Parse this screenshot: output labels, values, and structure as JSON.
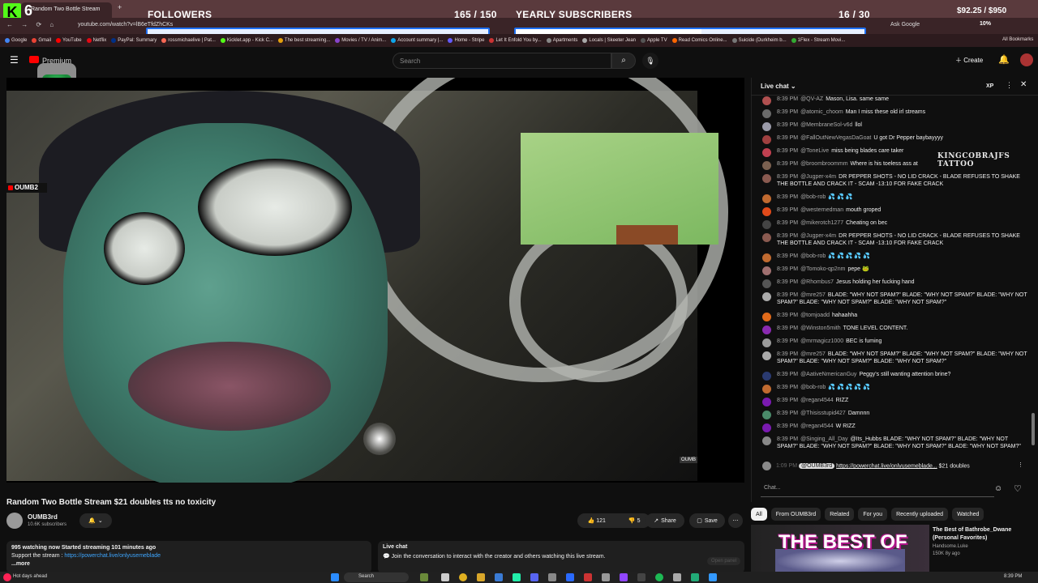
{
  "overlay": {
    "kick_logo": "K",
    "kick_count": "6",
    "followers_title": "FOLLOWERS",
    "followers_count": "165 / 150",
    "followers_progress": 1.0,
    "subs_title": "YEARLY SUBSCRIBERS",
    "subs_count": "16 / 30",
    "subs_progress": 0.533,
    "money": "$92.25 / $950",
    "progress_color": "#1d6ff2"
  },
  "browser": {
    "tab_title": "Random Two Bottle Stream",
    "new_tab": "+",
    "url": "youtube.com/watch?v=lB6eTfdZhCKs",
    "ask_google": "Ask Google",
    "zoom": "10%",
    "all_bookmarks": "All Bookmarks",
    "bookmarks": [
      "Google",
      "Gmail",
      "YouTube",
      "Netflix",
      "PayPal: Summary",
      "rossmichaelive | Pat...",
      "Kicklet.app - Kick C...",
      "The best streaming...",
      "Movies / TV / Anim...",
      "Account summary |...",
      "Home - Stripe",
      "Let It Enfold You by...",
      "Apartments",
      "Locals | Skeeter Jean",
      "Apple TV",
      "Read Comics Online...",
      "Suicide (Durkheim b...",
      "1Flex - Stream Movi..."
    ]
  },
  "yt": {
    "premium": "Premium",
    "search_placeholder": "Search",
    "create": "Create"
  },
  "video": {
    "channel_badge": "OUMB2",
    "corner_tag": "OUMB"
  },
  "below": {
    "title": "Random Two Bottle Stream $21 doubles tts no toxicity",
    "channel": "OUMB3rd",
    "subs": "10.6K subscribers",
    "likes": "121",
    "dislikes": "5",
    "share": "Share",
    "save": "Save",
    "watching": "995 watching now  Started streaming 101 minutes ago",
    "support": "Support the stream : ",
    "support_link": "https://powerchat.live/onlyusemeblade",
    "more": "...more",
    "livechat_title": "Live chat",
    "livechat_text": "Join the conversation to interact with the creator and others watching this live stream.",
    "open_panel": "Open panel"
  },
  "chat": {
    "header": "Live chat",
    "xp": "XP",
    "watermark": "KINGCOBRAJFS TATTOO",
    "messages": [
      {
        "time": "8:39 PM",
        "name": "@QV-AZ",
        "text": "Mason, Lisa. same same",
        "color": "#b05050"
      },
      {
        "time": "8:39 PM",
        "name": "@atomic_choom",
        "text": "Man I miss these old irl streams",
        "color": "#6a6a6a"
      },
      {
        "time": "8:39 PM",
        "name": "@MembraneSol-v6d",
        "text": "llol",
        "color": "#9a9aa8"
      },
      {
        "time": "8:39 PM",
        "name": "@FallOutNewVegasDaGoat",
        "text": "U got Dr Pepper baybayyyy",
        "color": "#a04040"
      },
      {
        "time": "8:39 PM",
        "name": "@ToneLive",
        "text": "miss being blades care taker",
        "color": "#c04050"
      },
      {
        "time": "8:39 PM",
        "name": "@broombroommm",
        "text": "Where is his toeless ass at",
        "color": "#7a6050"
      },
      {
        "time": "8:39 PM",
        "name": "@Jugper-x4m",
        "text": "DR PEPPER SHOTS - NO LID CRACK - BLADE REFUSES TO SHAKE THE BOTTLE AND CRACK IT - SCAM -13:10 FOR FAKE CRACK",
        "color": "#8a5a50"
      },
      {
        "time": "8:39 PM",
        "name": "@bob-rob",
        "text": "💦 💦 💦",
        "color": "#c06a30"
      },
      {
        "time": "8:39 PM",
        "name": "@westernedman",
        "text": "mouth groped",
        "color": "#e04a1a"
      },
      {
        "time": "8:39 PM",
        "name": "@mikerotch1277",
        "text": "Cheating on bec",
        "color": "#444"
      },
      {
        "time": "8:39 PM",
        "name": "@Jugper-x4m",
        "text": "DR PEPPER SHOTS - NO LID CRACK - BLADE REFUSES TO SHAKE THE BOTTLE AND CRACK IT - SCAM -13:10 FOR FAKE CRACK",
        "color": "#8a5a50"
      },
      {
        "time": "8:39 PM",
        "name": "@bob-rob",
        "text": "💦 💦 💦 💦 💦",
        "color": "#c06a30"
      },
      {
        "time": "8:39 PM",
        "name": "@Tomoko-qp2nm",
        "text": "pepe 🐸",
        "color": "#a07070"
      },
      {
        "time": "8:39 PM",
        "name": "@Rhombus7",
        "text": "Jesus holding her fucking hand",
        "color": "#555"
      },
      {
        "time": "8:39 PM",
        "name": "@mre257",
        "text": "BLADE: \"WHY NOT SPAM?\" BLADE: \"WHY NOT SPAM?\" BLADE: \"WHY NOT SPAM?\" BLADE: \"WHY NOT SPAM?\" BLADE: \"WHY NOT SPAM?\"",
        "color": "#aaa"
      },
      {
        "time": "8:39 PM",
        "name": "@tomjoadd",
        "text": "hahaahha",
        "color": "#e06a1a"
      },
      {
        "time": "8:39 PM",
        "name": "@Winston5mith",
        "text": "TONE LEVEL CONTENT.",
        "color": "#8a2ab0"
      },
      {
        "time": "8:39 PM",
        "name": "@mrmagicz1000",
        "text": "BEC is fuming",
        "color": "#9a9a9a"
      },
      {
        "time": "8:39 PM",
        "name": "@mre257",
        "text": "BLADE: \"WHY NOT SPAM?\" BLADE: \"WHY NOT SPAM?\" BLADE: \"WHY NOT SPAM?\" BLADE: \"WHY NOT SPAM?\" BLADE: \"WHY NOT SPAM?\"",
        "color": "#aaa"
      },
      {
        "time": "8:39 PM",
        "name": "@AativeNmericanGuy",
        "text": "Peggy's still wanting attention brine?",
        "color": "#2a3a70"
      },
      {
        "time": "8:39 PM",
        "name": "@bob-rob",
        "text": "💦 💦 💦 💦 💦",
        "color": "#c06a30"
      },
      {
        "time": "8:39 PM",
        "name": "@regan4544",
        "text": "RIZZ",
        "color": "#7a1ab0"
      },
      {
        "time": "8:39 PM",
        "name": "@Thisisstupid427",
        "text": "Damnnn",
        "color": "#4a8a6a"
      },
      {
        "time": "8:39 PM",
        "name": "@regan4544",
        "text": "W RIZZ",
        "color": "#7a1ab0"
      },
      {
        "time": "8:39 PM",
        "name": "@Singing_All_Day",
        "text": "@Its_Hubbs BLADE: \"WHY NOT SPAM?\" BLADE: \"WHY NOT SPAM?\" BLADE: \"WHY NOT SPAM?\" BLADE: \"WHY NOT SPAM?\" BLADE: \"WHY NOT SPAM?\"",
        "color": "#888"
      }
    ],
    "pinned_time": "1:09 PM",
    "pinned_name": "@OUMB3rd",
    "pinned_link": "https://powerchat.live/onlyusemeblade...",
    "pinned_suffix": " $21 doubles",
    "input_placeholder": "Chat..."
  },
  "recs": {
    "chips": [
      "All",
      "From OUMB3rd",
      "Related",
      "For you",
      "Recently uploaded",
      "Watched"
    ],
    "thumb_text": "THE BEST OF",
    "title": "The Best of Bathrobe_Dwane (Personal Favorites)",
    "channel": "Handsome.Luke",
    "meta": "150K  8y ago"
  },
  "taskbar": {
    "weather": "Hot days ahead",
    "search": "Search",
    "time": "8:39 PM"
  }
}
